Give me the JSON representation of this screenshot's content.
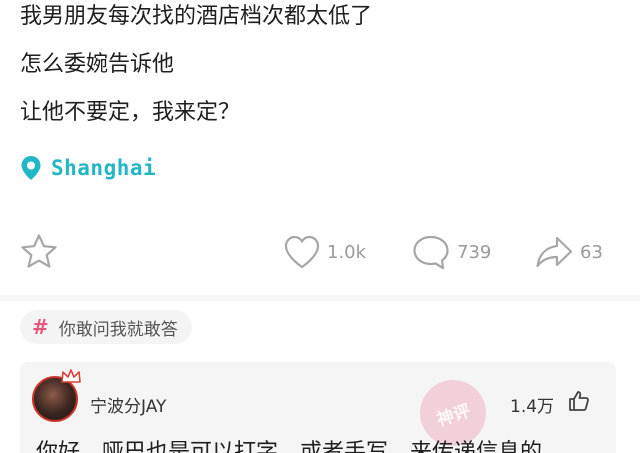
{
  "post": {
    "lines": [
      "我男朋友每次找的酒店档次都太低了",
      "怎么委婉告诉他",
      "让他不要定，我来定？"
    ]
  },
  "location": {
    "icon": "location-pin-icon",
    "label": "Shanghai",
    "color": "#22b6c6"
  },
  "actions": {
    "favorite": {
      "icon": "star-icon"
    },
    "like": {
      "icon": "heart-icon",
      "count": "1.0k"
    },
    "comment": {
      "icon": "speech-bubble-icon",
      "count": "739"
    },
    "share": {
      "icon": "share-arrow-icon",
      "count": "63"
    }
  },
  "topic": {
    "hash": "#",
    "label": "你敢问我就敢答",
    "hash_color": "#e5587b"
  },
  "top_comment": {
    "author": "宁波分JAY",
    "likes": "1.4万",
    "stamp": "神评",
    "text": "你好，哑巴也是可以打字，或者手写，来传递信息的"
  }
}
